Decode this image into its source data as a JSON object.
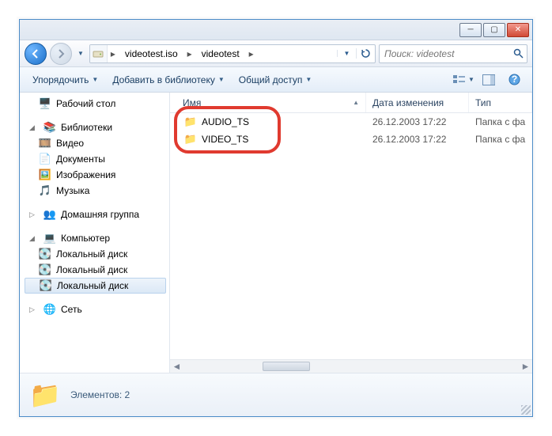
{
  "breadcrumb": {
    "seg1": "videotest.iso",
    "seg2": "videotest"
  },
  "search": {
    "placeholder": "Поиск: videotest"
  },
  "toolbar": {
    "organize": "Упорядочить",
    "addlib": "Добавить в библиотеку",
    "share": "Общий доступ"
  },
  "columns": {
    "name": "Имя",
    "date": "Дата изменения",
    "type": "Тип"
  },
  "rows": [
    {
      "name": "AUDIO_TS",
      "date": "26.12.2003 17:22",
      "type": "Папка с фа"
    },
    {
      "name": "VIDEO_TS",
      "date": "26.12.2003 17:22",
      "type": "Папка с фа"
    }
  ],
  "tree": {
    "desktop": "Рабочий стол",
    "libs": "Библиотеки",
    "video": "Видео",
    "docs": "Документы",
    "images": "Изображения",
    "music": "Музыка",
    "homegroup": "Домашняя группа",
    "computer": "Компьютер",
    "disk1": "Локальный диск",
    "disk2": "Локальный диск",
    "disk3": "Локальный диск",
    "network": "Сеть"
  },
  "status": {
    "text": "Элементов: 2"
  }
}
